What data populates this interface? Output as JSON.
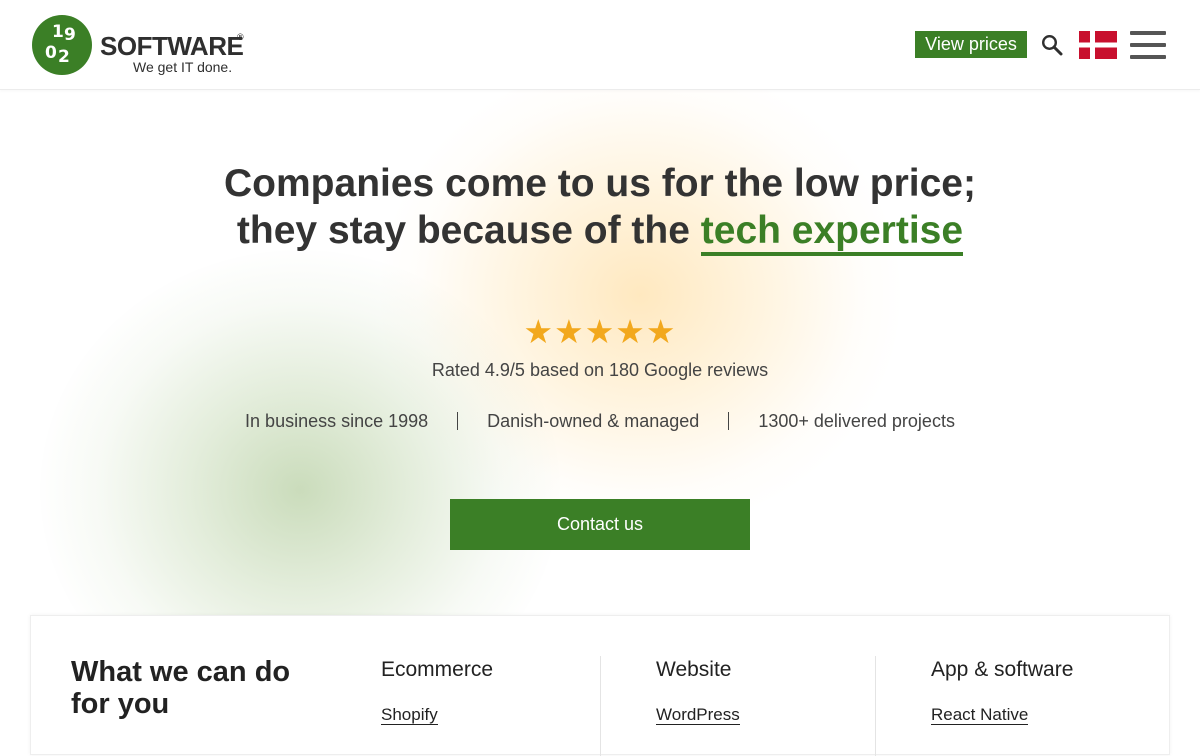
{
  "header": {
    "logo_mark": [
      "1",
      "9",
      "0",
      "2"
    ],
    "logo_name": "SOFTWARE",
    "logo_registered": "®",
    "logo_tagline": "We get IT done.",
    "view_prices_label": "View prices",
    "icons": {
      "search": "search-icon",
      "flag": "denmark-flag-icon",
      "menu": "hamburger-menu-icon"
    }
  },
  "hero": {
    "title_line1": "Companies come to us for the low price;",
    "title_line2_prefix": "they stay because of the ",
    "title_accent": "tech expertise",
    "stars": "★★★★★",
    "rating_value": 4.9,
    "rating_max": 5,
    "rating_text": "Rated 4.9/5 based on 180 Google reviews",
    "facts": [
      "In business since 1998",
      "Danish-owned & managed",
      "1300+ delivered projects"
    ],
    "contact_label": "Contact us"
  },
  "services": {
    "heading": "What we can do for you",
    "columns": [
      {
        "title": "Ecommerce",
        "link": "Shopify"
      },
      {
        "title": "Website",
        "link": "WordPress"
      },
      {
        "title": "App & software",
        "link": "React Native"
      }
    ]
  },
  "colors": {
    "brand_green": "#3b7f26",
    "star_gold": "#f2a81d",
    "flag_red": "#c8102e",
    "text_dark": "#333333"
  }
}
